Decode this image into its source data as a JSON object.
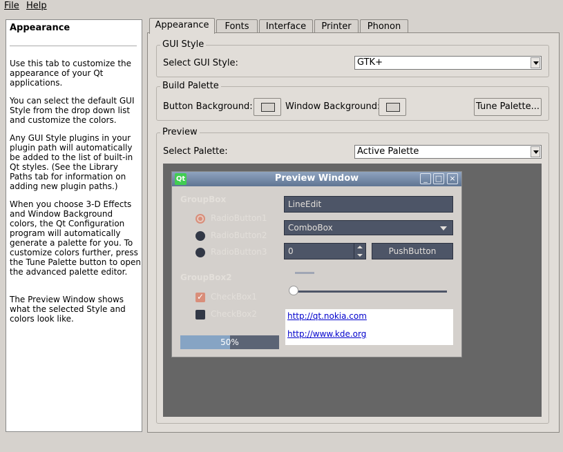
{
  "menubar": {
    "file": "File",
    "help": "Help"
  },
  "help": {
    "title": "Appearance",
    "paragraphs": [
      "Use this tab to customize the appearance of your Qt applications.",
      "You can select the default GUI Style from the drop down list and customize the colors.",
      "Any GUI Style plugins in your plugin path will automatically be added to the list of built-in Qt styles. (See the Library Paths tab for information on adding new plugin paths.)",
      "When you choose 3-D Effects and Window Background colors, the Qt Configuration program will automatically generate a palette for you. To customize colors further, press the Tune Palette button to open the advanced palette editor.",
      "The Preview Window shows what the selected Style and colors look like."
    ]
  },
  "tabs": [
    "Appearance",
    "Fonts",
    "Interface",
    "Printer",
    "Phonon"
  ],
  "gui_style": {
    "group_title": "GUI Style",
    "label": "Select GUI Style:",
    "value": "GTK+"
  },
  "build_palette": {
    "group_title": "Build Palette",
    "button_bg_label": "Button Background:",
    "window_bg_label": "Window Background:",
    "tune_label": "Tune Palette..."
  },
  "preview": {
    "group_title": "Preview",
    "label": "Select Palette:",
    "value": "Active Palette",
    "window": {
      "title": "Preview Window",
      "logo": "Qt",
      "groupbox1": "GroupBox",
      "radio1": "RadioButton1",
      "radio2": "RadioButton2",
      "radio3": "RadioButton3",
      "groupbox2": "GroupBox2",
      "checkbox1": "CheckBox1",
      "checkbox2": "CheckBox2",
      "progress_text": "50%",
      "progress_value": 0.5,
      "lineedit": "LineEdit",
      "combobox": "ComboBox",
      "spinbox": "0",
      "pushbutton": "PushButton",
      "link1": "http://qt.nokia.com",
      "link2": "http://www.kde.org"
    }
  },
  "colors": {
    "window_bg": "#d6d2cd",
    "preview_dark": "#4d5567",
    "accent": "#d98e7a",
    "titlebar": "#6f84a2"
  }
}
